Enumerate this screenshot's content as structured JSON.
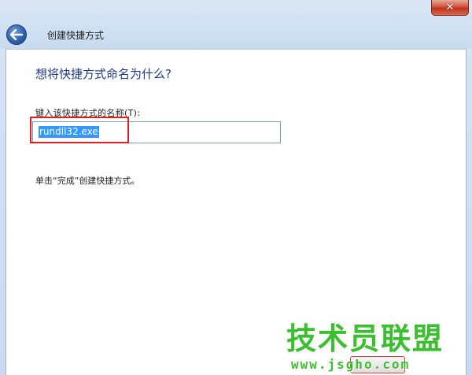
{
  "window": {
    "close_label": "✕"
  },
  "header": {
    "title": "创建快捷方式"
  },
  "main": {
    "heading": "想将快捷方式命名为什么?",
    "name_label": "键入该快捷方式的名称(T):",
    "name_value": "rundll32.exe",
    "instruction": "单击“完成”创建快捷方式。"
  },
  "watermark": {
    "brand": "技术员联盟",
    "url": "www.jsgho.com"
  },
  "colors": {
    "heading": "#1d3a8a",
    "selection": "#3399ff",
    "highlight": "#e02020",
    "watermark": "#3bbf2f"
  },
  "icons": {
    "back": "back-arrow-icon",
    "close": "close-icon"
  }
}
